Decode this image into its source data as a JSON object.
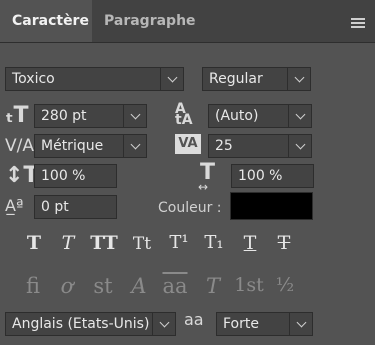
{
  "tabs": {
    "active": "Caractère",
    "inactive": "Paragraphe"
  },
  "font": {
    "family": "Toxico",
    "style": "Regular"
  },
  "size": {
    "value": "280 pt"
  },
  "leading": {
    "value": "(Auto)"
  },
  "kerning": {
    "value": "Métrique"
  },
  "tracking": {
    "value": "25"
  },
  "vscale": {
    "value": "100 %"
  },
  "hscale": {
    "value": "100 %"
  },
  "baseline": {
    "value": "0 pt"
  },
  "color": {
    "label": "Couleur :",
    "value": "#000000"
  },
  "style_buttons": [
    "T",
    "T",
    "TT",
    "Tt",
    "T¹",
    "T₁",
    "T",
    "T"
  ],
  "opentype_buttons": [
    "fi",
    "ơ",
    "st",
    "A",
    "aa",
    "T",
    "1st",
    "½"
  ],
  "language": {
    "value": "Anglais (Etats-Unis)"
  },
  "antialias": {
    "icon": "aa",
    "value": "Forte"
  }
}
